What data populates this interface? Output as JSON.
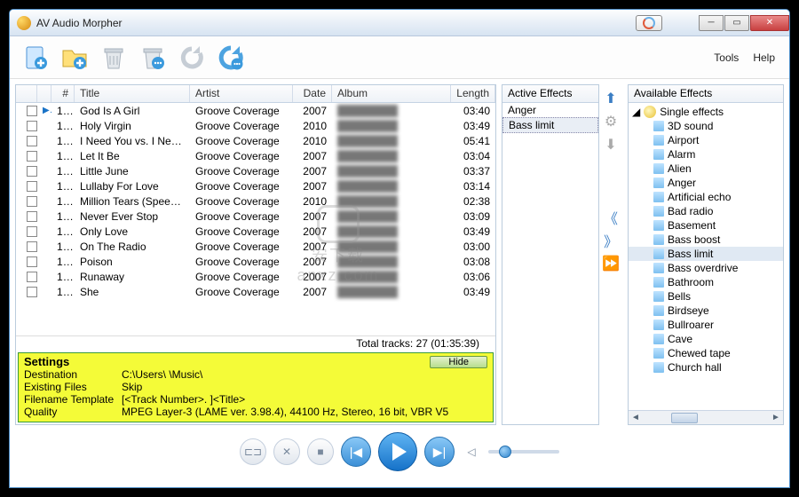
{
  "window": {
    "title": "AV Audio Morpher"
  },
  "menu": {
    "tools": "Tools",
    "help": "Help"
  },
  "columns": {
    "num": "#",
    "title": "Title",
    "artist": "Artist",
    "date": "Date",
    "album": "Album",
    "length": "Length"
  },
  "tracks": [
    {
      "n": "1...",
      "title": "God Is A Girl",
      "artist": "Groove Coverage",
      "date": "2007",
      "album": "",
      "length": "03:40",
      "playing": true
    },
    {
      "n": "1...",
      "title": "Holy Virgin",
      "artist": "Groove Coverage",
      "date": "2010",
      "album": "",
      "length": "03:49"
    },
    {
      "n": "1...",
      "title": "I Need You vs. I Need...",
      "artist": "Groove Coverage",
      "date": "2010",
      "album": "",
      "length": "05:41"
    },
    {
      "n": "1...",
      "title": "Let It Be",
      "artist": "Groove Coverage",
      "date": "2007",
      "album": "",
      "length": "03:04"
    },
    {
      "n": "1...",
      "title": "Little June",
      "artist": "Groove Coverage",
      "date": "2007",
      "album": "",
      "length": "03:37"
    },
    {
      "n": "1...",
      "title": "Lullaby For Love",
      "artist": "Groove Coverage",
      "date": "2007",
      "album": "",
      "length": "03:14"
    },
    {
      "n": "1...",
      "title": "Million Tears (Speed V...",
      "artist": "Groove Coverage",
      "date": "2010",
      "album": "",
      "length": "02:38"
    },
    {
      "n": "1...",
      "title": "Never Ever Stop",
      "artist": "Groove Coverage",
      "date": "2007",
      "album": "",
      "length": "03:09"
    },
    {
      "n": "1...",
      "title": "Only Love",
      "artist": "Groove Coverage",
      "date": "2007",
      "album": "",
      "length": "03:49"
    },
    {
      "n": "1...",
      "title": "On The Radio",
      "artist": "Groove Coverage",
      "date": "2007",
      "album": "",
      "length": "03:00"
    },
    {
      "n": "1...",
      "title": "Poison",
      "artist": "Groove Coverage",
      "date": "2007",
      "album": "",
      "length": "03:08"
    },
    {
      "n": "1...",
      "title": "Runaway",
      "artist": "Groove Coverage",
      "date": "2007",
      "album": "",
      "length": "03:06"
    },
    {
      "n": "1...",
      "title": "She",
      "artist": "Groove Coverage",
      "date": "2007",
      "album": "",
      "length": "03:49"
    }
  ],
  "total": "Total tracks: 27 (01:35:39)",
  "settings": {
    "heading": "Settings",
    "hide": "Hide",
    "destination_k": "Destination",
    "destination_v": "C:\\Users\\      \\Music\\",
    "existing_k": "Existing Files",
    "existing_v": "Skip",
    "template_k": "Filename Template",
    "template_v": "[<Track Number>. ]<Title>",
    "quality_k": "Quality",
    "quality_v": "MPEG Layer-3 (LAME ver. 3.98.4), 44100 Hz, Stereo, 16 bit, VBR V5"
  },
  "active_effects": {
    "heading": "Active Effects",
    "items": [
      "Anger",
      "Bass limit"
    ]
  },
  "available_effects": {
    "heading": "Available Effects",
    "root": "Single effects",
    "items": [
      "3D sound",
      "Airport",
      "Alarm",
      "Alien",
      "Anger",
      "Artificial echo",
      "Bad radio",
      "Basement",
      "Bass boost",
      "Bass limit",
      "Bass overdrive",
      "Bathroom",
      "Bells",
      "Birdseye",
      "Bullroarer",
      "Cave",
      "Chewed tape",
      "Church hall"
    ]
  },
  "watermark": {
    "text": "anxz.com",
    "sub": "安下载"
  }
}
